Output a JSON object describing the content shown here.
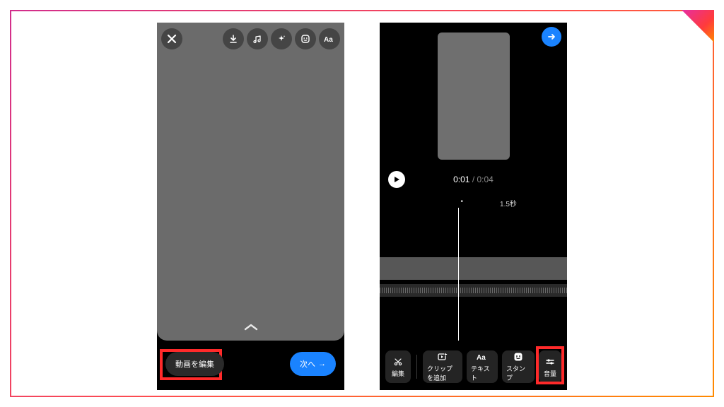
{
  "left": {
    "icons": {
      "close": "close-icon",
      "download": "download-icon",
      "music": "music-icon",
      "sparkle": "sparkle-icon",
      "sticker": "sticker-icon",
      "text": "text-icon"
    },
    "edit_button": "動画を編集",
    "next_button": "次へ",
    "next_arrow": "→"
  },
  "right": {
    "time_current": "0:01",
    "time_sep": " / ",
    "time_total": "0:04",
    "scale_dot": "•",
    "scale_label": "1.5秒",
    "tools": [
      {
        "id": "edit",
        "label": "編集"
      },
      {
        "id": "addclip",
        "label": "クリップを追加"
      },
      {
        "id": "text",
        "label": "テキスト"
      },
      {
        "id": "stamp",
        "label": "スタンプ"
      },
      {
        "id": "volume",
        "label": "音量"
      }
    ]
  }
}
